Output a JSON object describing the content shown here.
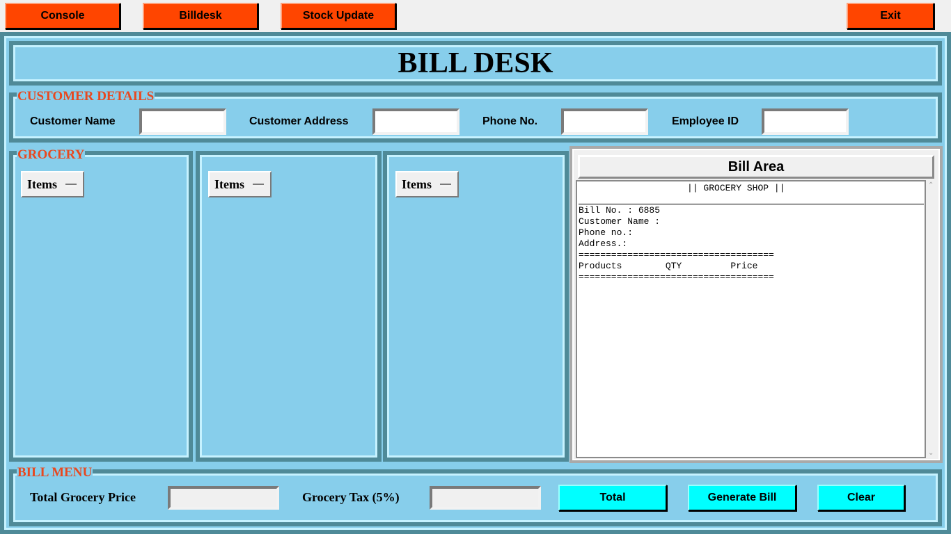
{
  "nav": {
    "console": "Console",
    "billdesk": "Billdesk",
    "stock_update": "Stock Update",
    "exit": "Exit"
  },
  "title": "BILL DESK",
  "customer": {
    "section": "CUSTOMER DETAILS",
    "name_label": "Customer Name",
    "address_label": "Customer Address",
    "phone_label": "Phone No.",
    "employee_label": "Employee ID",
    "name_value": "",
    "address_value": "",
    "phone_value": "",
    "employee_value": ""
  },
  "grocery": {
    "section": "GROCERY",
    "menus": [
      "Items",
      "Items",
      "Items"
    ]
  },
  "bill": {
    "header": "Bill Area",
    "text": "                    || GROCERY SHOP ||\n\nBill No. : 6885\nCustomer Name :\nPhone no.:\nAddress.:\n====================================\nProducts        QTY         Price\n===================================="
  },
  "bill_menu": {
    "section": "BILL MENU",
    "total_price_label": "Total Grocery Price",
    "tax_label": "Grocery Tax (5%)",
    "total_price_value": "",
    "tax_value": "",
    "total_btn": "Total",
    "generate_btn": "Generate Bill",
    "clear_btn": "Clear"
  },
  "colors": {
    "nav_button": "#ff4500",
    "panel": "#87ceeb",
    "section_label": "#e8481f",
    "action_button": "#00ffff"
  }
}
